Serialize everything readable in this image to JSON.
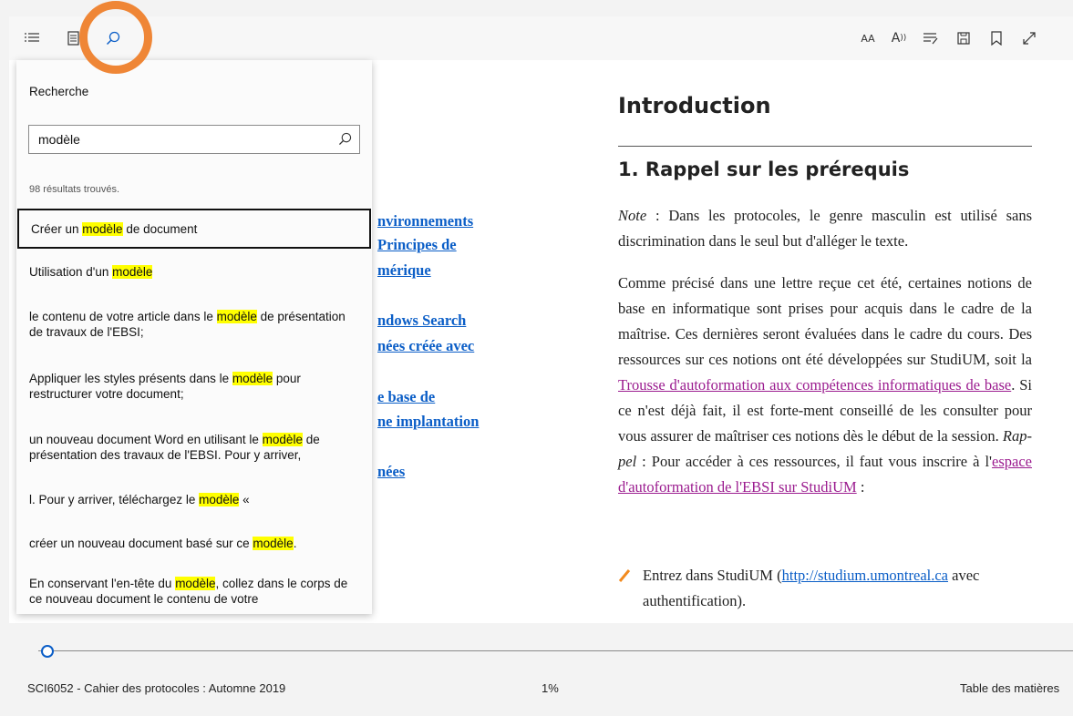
{
  "toolbar": {
    "left_icons": [
      "list-icon",
      "notes-icon",
      "search-icon"
    ],
    "right_icons": [
      "text-size-icon",
      "read-aloud-icon",
      "learning-tools-icon",
      "save-icon",
      "bookmark-icon",
      "fullscreen-icon"
    ],
    "text_size_label": "AA",
    "read_aloud_label": "A",
    "highlight_color": "#ef8636"
  },
  "search": {
    "title": "Recherche",
    "query": "modèle",
    "count": "98 résultats trouvés.",
    "results": [
      {
        "pre": "Créer un ",
        "hit": "modèle",
        "post": " de document"
      },
      {
        "pre": "Utilisation d'un ",
        "hit": "modèle",
        "post": ""
      },
      {
        "pre": " le contenu de votre article dans le ",
        "hit": "modèle",
        "post": " de présentation de travaux de l'EBSI;"
      },
      {
        "pre": "Appliquer les styles présents dans le ",
        "hit": "modèle",
        "post": " pour restructurer votre document;"
      },
      {
        "pre": " un nouveau document Word en utilisant le ",
        "hit": "modèle",
        "post": " de présentation des travaux de l'EBSI. Pour y arriver,"
      },
      {
        "pre": "l. Pour y arriver, téléchargez le ",
        "hit": "modèle",
        "post": " «"
      },
      {
        "pre": " créer un nouveau document basé sur ce ",
        "hit": "modèle",
        "post": "."
      },
      {
        "pre": "En conservant l'en-tête du ",
        "hit": "modèle",
        "post": ", collez dans le corps de ce nouveau document le contenu de votre"
      }
    ],
    "highlight_color": "#ffff00"
  },
  "toc": {
    "links": [
      "nvironnements",
      "Principes de",
      "mérique",
      "ndows Search",
      "nées créée avec",
      "e base de",
      "ne implantation",
      "nées"
    ]
  },
  "article": {
    "heading": "Introduction",
    "subheading": "1.  Rappel sur les prérequis",
    "note_label": "Note",
    "note_text": "  : Dans les protocoles, le genre masculin est utilisé sans discrimination dans le seul but d'alléger le texte.",
    "para2_a": "Comme précisé dans une lettre reçue cet été, certaines notions de base en informatique sont prises pour acquis dans le cadre de la maîtrise. Ces dernières seront évaluées dans le cadre du cours. Des ressources sur ces notions ont été développées sur StudiUM, soit la ",
    "para2_link1": "Trousse d'autoformation aux compétences informatiques de base",
    "para2_b": ". Si ce n'est déjà fait, il est forte-ment conseillé de les consulter pour vous assurer de maîtriser ces notions dès le début de la session. ",
    "para2_rappel": "Rap-pel",
    "para2_c": " : Pour accéder à ces ressources, il faut vous inscrire à l'",
    "para2_link2": "espace d'autoformation de l'EBSI sur StudiUM",
    "para2_d": " :",
    "bullet_a": "Entrez dans StudiUM (",
    "bullet_link": "http://studium.umontreal.ca",
    "bullet_b": " avec authentification)."
  },
  "bottom": {
    "book_title": "SCI6052 - Cahier des protocoles : Automne 2019",
    "progress_label": "1%",
    "progress": 0.01,
    "toc_label": "Table des matières"
  }
}
